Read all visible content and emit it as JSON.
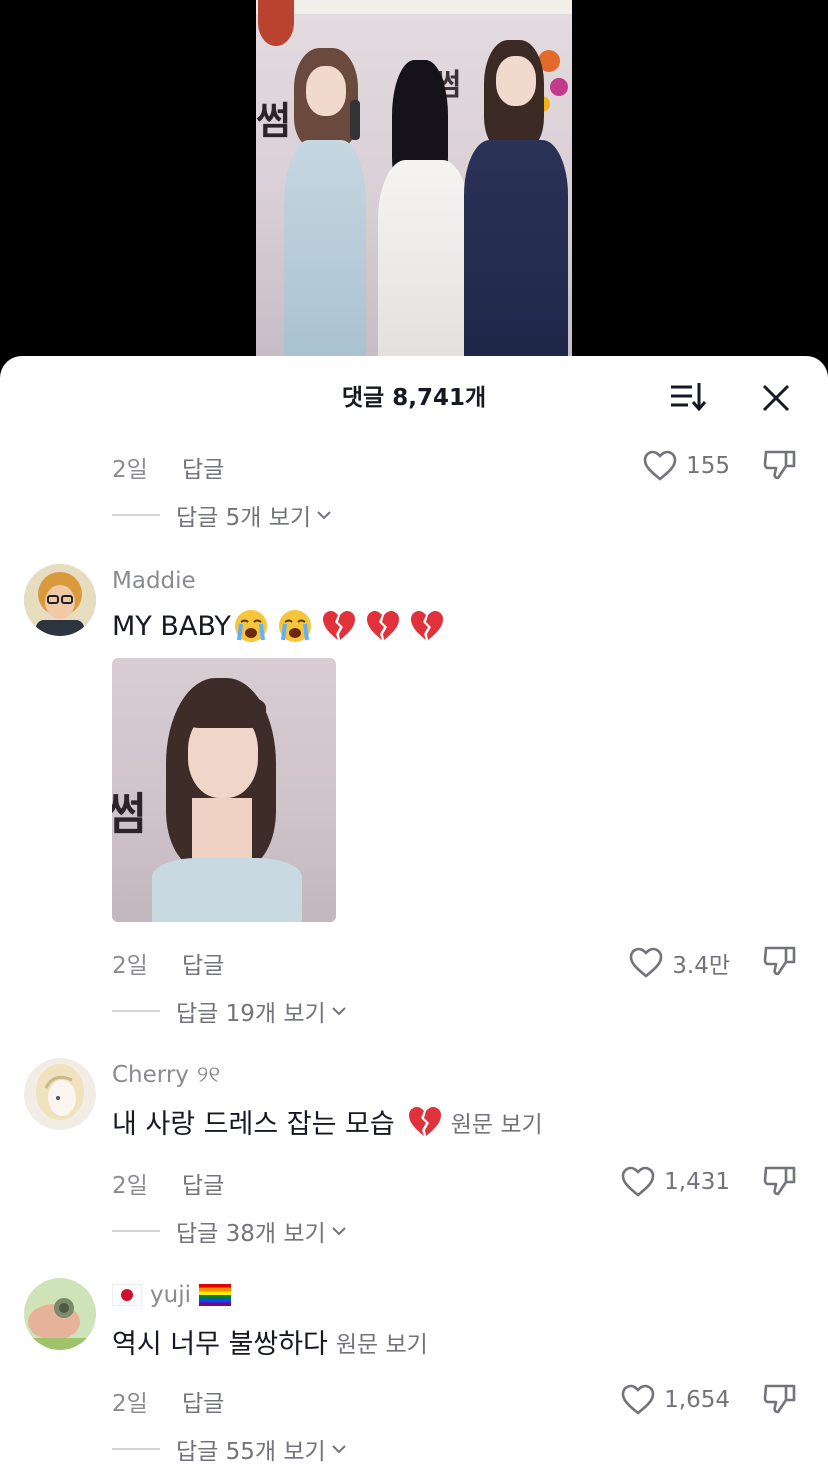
{
  "header": {
    "title": "댓글 8,741개"
  },
  "top_comment_meta": {
    "date": "2일",
    "reply_label": "답글",
    "likes": "155",
    "view_replies": "답글 5개 보기"
  },
  "comments": [
    {
      "username": "Maddie",
      "text": "MY BABY",
      "emojis": [
        "loudly-crying-face",
        "loudly-crying-face",
        "broken-heart",
        "broken-heart",
        "broken-heart"
      ],
      "has_image": true,
      "image_caption": "썸",
      "date": "2일",
      "reply_label": "답글",
      "likes": "3.4만",
      "view_replies": "답글 19개 보기"
    },
    {
      "username": "Cherry",
      "username_suffix": "୨୧",
      "text": "내 사랑 드레스 잡는 모습",
      "emojis": [
        "broken-heart"
      ],
      "translate_label": "원문 보기",
      "date": "2일",
      "reply_label": "답글",
      "likes": "1,431",
      "view_replies": "답글 38개 보기"
    },
    {
      "username": "yuji",
      "username_prefix_icon": "japan-flag",
      "username_suffix_icon": "rainbow-flag",
      "text": "역시 너무 불쌍하다",
      "translate_label": "원문 보기",
      "date": "2일",
      "reply_label": "답글",
      "likes": "1,654",
      "view_replies": "답글 55개 보기"
    }
  ],
  "video": {
    "banner_text": "빅썸",
    "side_text": "썸"
  },
  "colors": {
    "sheet_bg": "#ffffff",
    "text_primary": "#161823",
    "text_secondary": "#8a8b91",
    "backdrop": "#000000",
    "broken_heart": "#e1323c"
  }
}
